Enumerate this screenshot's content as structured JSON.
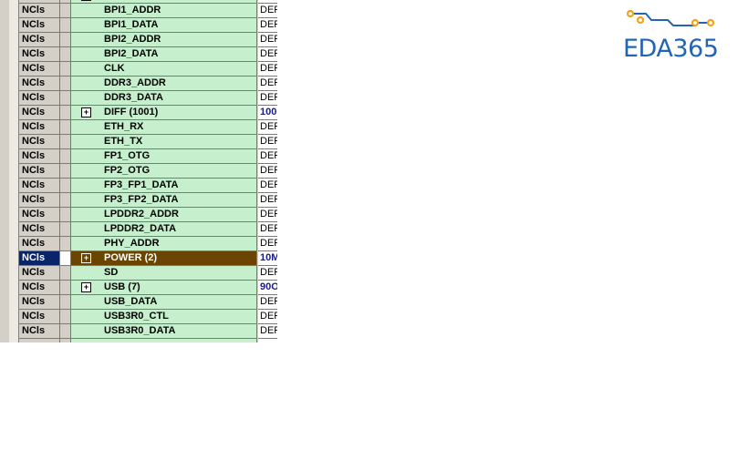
{
  "grid": {
    "rows": [
      {
        "type": "NCls",
        "name": "",
        "value": "",
        "expandable": true,
        "partial": true
      },
      {
        "type": "NCls",
        "name": "BPI1_ADDR",
        "value": "DEF"
      },
      {
        "type": "NCls",
        "name": "BPI1_DATA",
        "value": "DEF"
      },
      {
        "type": "NCls",
        "name": "BPI2_ADDR",
        "value": "DEF"
      },
      {
        "type": "NCls",
        "name": "BPI2_DATA",
        "value": "DEF"
      },
      {
        "type": "NCls",
        "name": "CLK",
        "value": "DEF"
      },
      {
        "type": "NCls",
        "name": "DDR3_ADDR",
        "value": "DEF"
      },
      {
        "type": "NCls",
        "name": "DDR3_DATA",
        "value": "DEF"
      },
      {
        "type": "NCls",
        "name": "DIFF (1001)",
        "value": "100",
        "expandable": true,
        "bold_value": true
      },
      {
        "type": "NCls",
        "name": "ETH_RX",
        "value": "DEF"
      },
      {
        "type": "NCls",
        "name": "ETH_TX",
        "value": "DEF"
      },
      {
        "type": "NCls",
        "name": "FP1_OTG",
        "value": "DEF"
      },
      {
        "type": "NCls",
        "name": "FP2_OTG",
        "value": "DEF"
      },
      {
        "type": "NCls",
        "name": "FP3_FP1_DATA",
        "value": "DEF"
      },
      {
        "type": "NCls",
        "name": "FP3_FP2_DATA",
        "value": "DEF"
      },
      {
        "type": "NCls",
        "name": "LPDDR2_ADDR",
        "value": "DEF"
      },
      {
        "type": "NCls",
        "name": "LPDDR2_DATA",
        "value": "DEF"
      },
      {
        "type": "NCls",
        "name": "PHY_ADDR",
        "value": "DEF"
      },
      {
        "type": "NCls",
        "name": "POWER (2)",
        "value": "10M",
        "expandable": true,
        "selected": true
      },
      {
        "type": "NCls",
        "name": "SD",
        "value": "DEF"
      },
      {
        "type": "NCls",
        "name": "USB (7)",
        "value": "90O",
        "expandable": true,
        "bold_value": true
      },
      {
        "type": "NCls",
        "name": "USB_DATA",
        "value": "DEF"
      },
      {
        "type": "NCls",
        "name": "USB3R0_CTL",
        "value": "DEF"
      },
      {
        "type": "NCls",
        "name": "USB3R0_DATA",
        "value": "DEF"
      },
      {
        "type": "",
        "name": "",
        "value": "",
        "partial": true
      }
    ]
  },
  "logo": {
    "text": "EDA365",
    "color": "#2365b5",
    "accent": "#f0a21a"
  },
  "colors": {
    "name_bg": "#c6efce",
    "selected_type_bg": "#0a246a",
    "selected_name_bg": "#6b4500"
  }
}
